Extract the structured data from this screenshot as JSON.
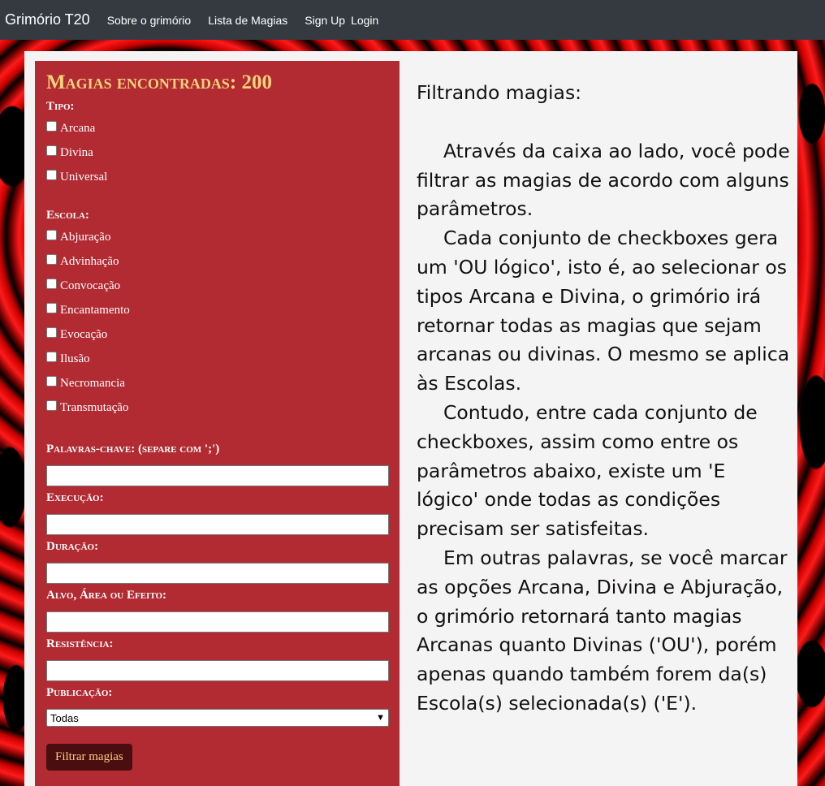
{
  "navbar": {
    "brand": "Grimório T20",
    "links": [
      "Sobre o grimório",
      "Lista de Magias",
      "Sign Up",
      "Login"
    ]
  },
  "filter": {
    "title": "Magias encontradas: 200",
    "tipo_label": "Tipo:",
    "tipos": [
      "Arcana",
      "Divina",
      "Universal"
    ],
    "escola_label": "Escola:",
    "escolas": [
      "Abjuração",
      "Advinhação",
      "Convocação",
      "Encantamento",
      "Evocação",
      "Ilusão",
      "Necromancia",
      "Transmutação"
    ],
    "fields": {
      "palavras_chave": "Palavras-chave: (separe com ';')",
      "execucao": "Execução:",
      "duracao": "Duração:",
      "alvo": "Alvo, Área ou Efeito:",
      "resistencia": "Resistência:",
      "publicacao": "Publicação:"
    },
    "publicacao_value": "Todas",
    "button": "Filtrar magias"
  },
  "info": {
    "heading": "Filtrando magias:",
    "paragraphs": [
      "Através da caixa ao lado, você pode filtrar as magias de acordo com alguns parâmetros.",
      "Cada conjunto de checkboxes gera um 'OU lógico', isto é, ao selecionar os tipos Arcana e Divina, o grimório irá retornar todas as magias que sejam arcanas ou divinas. O mesmo se aplica às Escolas.",
      "Contudo, entre cada conjunto de checkboxes, assim como entre os parâmetros abaixo, existe um 'E lógico' onde todas as condições precisam ser satisfeitas.",
      "Em outras palavras, se você marcar as opções Arcana, Divina e Abjuração, o grimório retornará tanto magias Arcanas quanto Divinas ('OU'), porém apenas quando também forem da(s) Escola(s) selecionada(s) ('E')."
    ]
  },
  "colors": {
    "navbar": "#343a40",
    "filter_box": "#b22a32",
    "title_gold": "#f6d27a",
    "button_bg": "#4a0d10"
  }
}
